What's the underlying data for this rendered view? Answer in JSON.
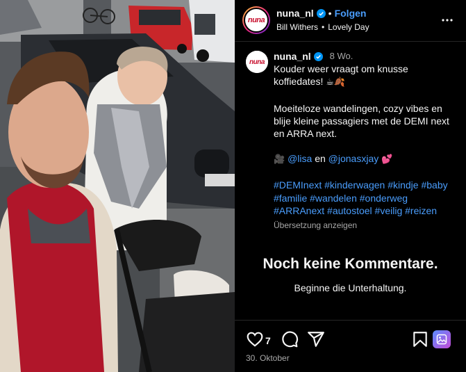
{
  "header": {
    "username": "nuna_nl",
    "separator": "•",
    "follow_label": "Folgen",
    "audio_artist": "Bill Withers",
    "audio_title": "Lovely Day",
    "avatar_text": "nuna"
  },
  "caption": {
    "username": "nuna_nl",
    "time_ago": "8 Wo.",
    "line1": "Kouder weer vraagt om knusse",
    "line2_text": "koffiedates!",
    "line2_emoji": "☕🍂",
    "para2": [
      "Moeiteloze wandelingen, cozy vibes en",
      "blije kleine passagiers met de DEMI next",
      "en ARRA next."
    ],
    "credits_icon": "🎥",
    "credit_user1": "@lisa",
    "credit_join": "en",
    "credit_user2": "@jonasxjay",
    "credit_emoji": "💕",
    "hashtags": [
      [
        "#DEMInext",
        "#kinderwagen",
        "#kindje",
        "#baby"
      ],
      [
        "#familie",
        "#wandelen",
        "#onderweg"
      ],
      [
        "#ARRAnext",
        "#autostoel",
        "#veilig",
        "#reizen"
      ]
    ],
    "translate_label": "Übersetzung anzeigen"
  },
  "comments": {
    "empty_title": "Noch keine Kommentare.",
    "empty_subtitle": "Beginne die Unterhaltung."
  },
  "actions": {
    "like_count": "7",
    "date": "30. Oktober",
    "icons": [
      "heart-icon",
      "comment-icon",
      "share-icon",
      "bookmark-icon",
      "gallery-icon"
    ]
  },
  "colors": {
    "accent": "#4a9dfc",
    "background": "#000000",
    "muted": "#a8a8a8"
  }
}
